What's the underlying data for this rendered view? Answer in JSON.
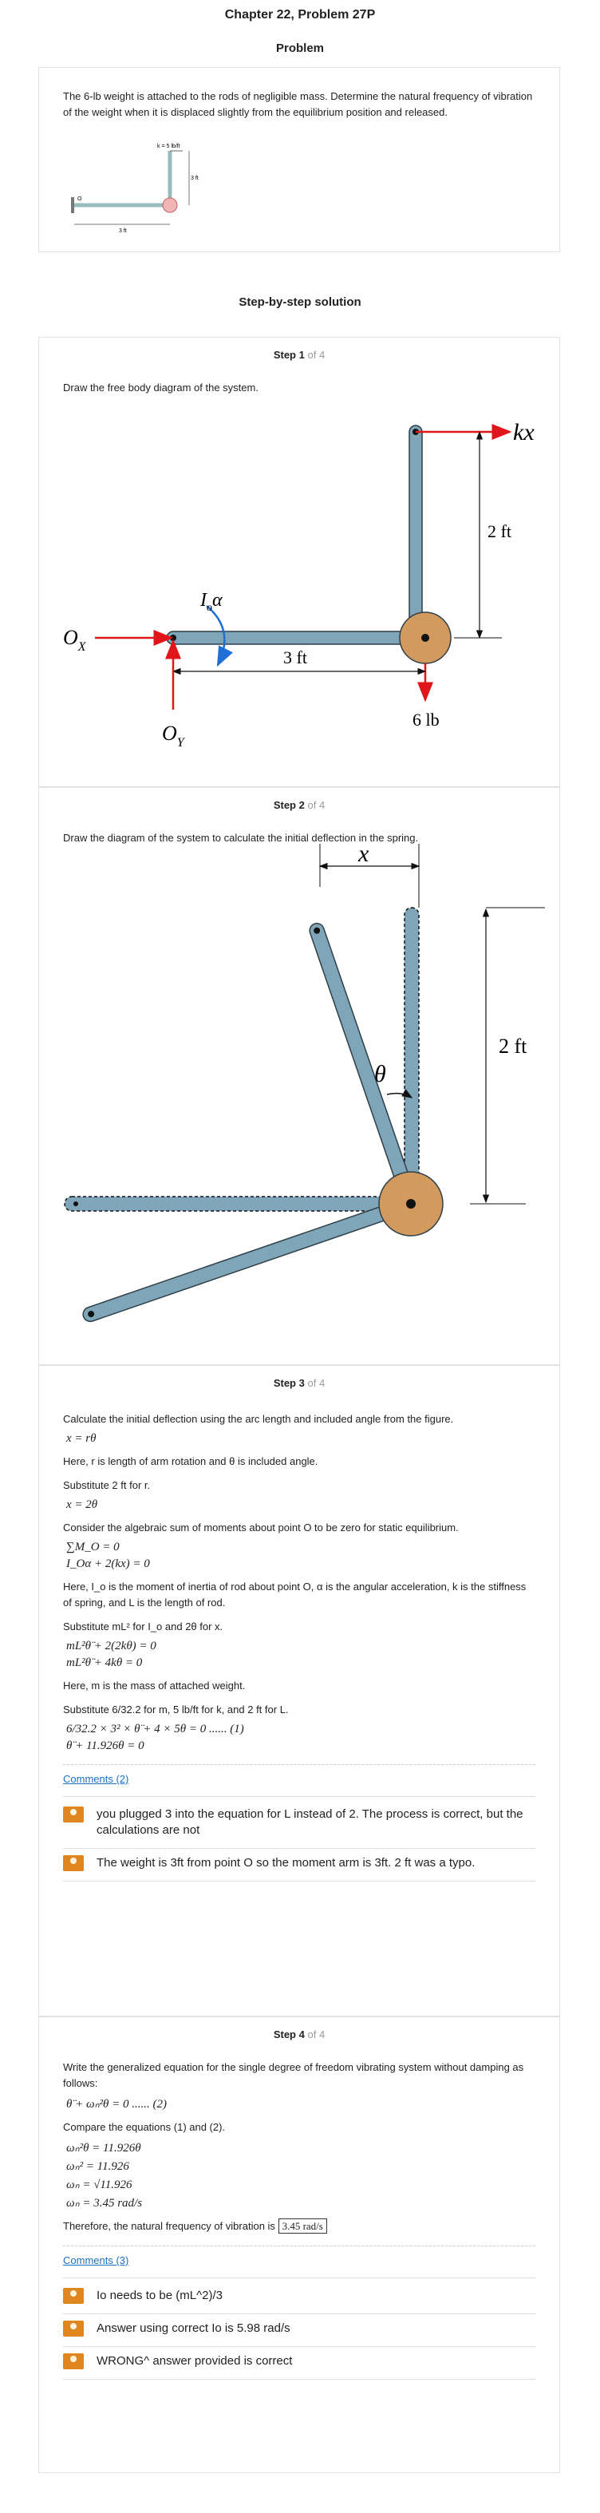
{
  "title": "Chapter 22, Problem 27P",
  "problem_heading": "Problem",
  "problem_text": "The 6-lb weight is attached to the rods of negligible mass. Determine the natural frequency of vibration of the weight when it is displaced slightly from the equilibrium position and released.",
  "problem_figure": {
    "k_label": "k = 5 lb/ft",
    "h_label": "3 ft",
    "w_label": "3 ft",
    "o_label": "O"
  },
  "solution_heading": "Step-by-step solution",
  "step_word": "Step",
  "of_total": "of 4",
  "steps": [
    {
      "num": "1",
      "text": "Draw the free body diagram of the system.",
      "fig": {
        "kx": "kx",
        "two_ft": "2 ft",
        "three_ft": "3 ft",
        "six_lb": "6 lb",
        "ox": "O",
        "ox_sub": "X",
        "oy": "O",
        "oy_sub": "Y",
        "io": "I",
        "io_sub": "o",
        "alpha": "α"
      }
    },
    {
      "num": "2",
      "text": "Draw the diagram of the system to calculate the initial deflection in the spring.",
      "fig": {
        "x": "x",
        "theta": "θ",
        "two_ft": "2 ft"
      }
    },
    {
      "num": "3",
      "t1": "Calculate the initial deflection using the arc length and included angle from the figure.",
      "e1": "x = rθ",
      "t2": "Here, r is length of arm rotation and  θ is included angle.",
      "t3": "Substitute 2 ft for r.",
      "e2": "x = 2θ",
      "t4": "Consider the algebraic sum of moments about point O to be zero for static equilibrium.",
      "e3": "∑M_O = 0",
      "e4": "I_Oα + 2(kx) = 0",
      "t5": "Here,  I_o is the moment of inertia of rod about point O,  α is the angular acceleration,  k is the stiffness of spring, and  L is the length of rod.",
      "t6": "Substitute  mL² for  I_o and  2θ for  x.",
      "e5": "mL²θ̈ + 2(2kθ) = 0",
      "e6": "mL²θ̈ + 4kθ = 0",
      "t7": "Here,  m is the mass of attached weight.",
      "t8": "Substitute  6/32.2 for  m,  5 lb/ft for  k, and  2 ft for  L.",
      "e7": "6/32.2 × 3² × θ̈ + 4 × 5θ = 0   ...... (1)",
      "e8": "θ̈ + 11.926θ = 0",
      "comments_link": "Comments (2)",
      "comments": [
        "you plugged 3 into the equation for L instead of 2. The process is correct, but the calculations are not",
        "The weight is 3ft from point O so the moment arm is 3ft. 2 ft was a typo."
      ]
    },
    {
      "num": "4",
      "t1": "Write the generalized equation for the single degree of freedom vibrating system without damping as follows:",
      "e1": "θ̈ + ωₙ²θ = 0  ...... (2)",
      "t2": "Compare the equations  (1) and  (2).",
      "e2": "ωₙ²θ = 11.926θ",
      "e3": "ωₙ² = 11.926",
      "e4": "ωₙ = √11.926",
      "e5": "ωₙ = 3.45  rad/s",
      "t3": "Therefore, the natural frequency of vibration is",
      "answer": "3.45  rad/s",
      "comments_link": "Comments (3)",
      "comments": [
        "Io needs to be (mL^2)/3",
        "Answer using correct Io is 5.98 rad/s",
        "WRONG^ answer provided is correct"
      ]
    }
  ],
  "colors": {
    "rod": "#7fa6b8",
    "mass": "#d39a5f",
    "arrow": "#e0161b",
    "blue_arrow": "#1f6fd6",
    "link": "#1a6fbf",
    "avatar": "#e0861f"
  }
}
